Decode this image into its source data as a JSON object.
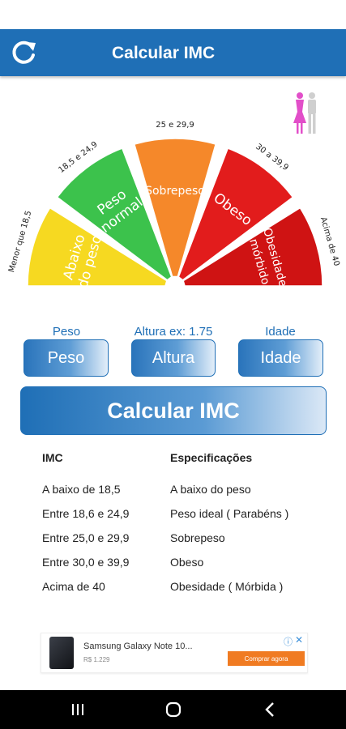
{
  "app": {
    "title": "Calcular IMC"
  },
  "icons": {
    "refresh": "refresh-icon",
    "gender": "gender-toggle-icon"
  },
  "gauge": {
    "segments": [
      {
        "label_lines": [
          "Abaixo",
          "do peso"
        ],
        "range": "Menor que 18,5",
        "color": "#f6d921"
      },
      {
        "label_lines": [
          "Peso",
          "normal"
        ],
        "range": "18,5 e 24,9",
        "color": "#3cc24c"
      },
      {
        "label_lines": [
          "Sobrepeso"
        ],
        "range": "25 e 29,9",
        "color": "#f5882a"
      },
      {
        "label_lines": [
          "Obeso"
        ],
        "range": "30 a 39,9",
        "color": "#e21c1c"
      },
      {
        "label_lines": [
          "Obesidade",
          "mórbido"
        ],
        "range": "Acima de 40",
        "color": "#cf1313"
      }
    ]
  },
  "inputs": {
    "peso": {
      "label": "Peso",
      "button": "Peso"
    },
    "altura": {
      "label": "Altura ex: 1.75",
      "button": "Altura"
    },
    "idade": {
      "label": "Idade",
      "button": "Idade"
    }
  },
  "calc_button": "Calcular IMC",
  "table": {
    "headers": [
      "IMC",
      "Especificações"
    ],
    "rows": [
      [
        "A baixo de 18,5",
        "A baixo do peso"
      ],
      [
        "Entre 18,6 e 24,9",
        "Peso ideal ( Parabéns )"
      ],
      [
        "Entre 25,0 e 29,9",
        "Sobrepeso"
      ],
      [
        "Entre 30,0 e 39,9",
        "Obeso"
      ],
      [
        "Acima de 40",
        "Obesidade ( Mórbida )"
      ]
    ]
  },
  "ad": {
    "title": "Samsung Galaxy Note 10...",
    "price": "R$ 1.229",
    "cta": "Comprar agora",
    "accent": "#f07b22"
  },
  "colors": {
    "primary": "#1f6fb6"
  }
}
